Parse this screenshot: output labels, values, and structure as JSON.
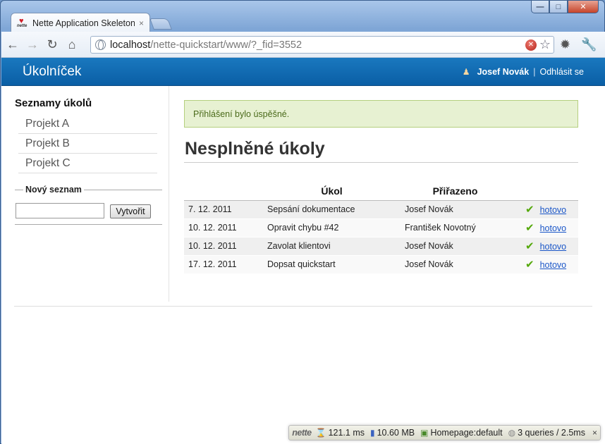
{
  "browser": {
    "tab_title": "Nette Application Skeleton",
    "tab_close": "×",
    "url_host": "localhost",
    "url_rest": "/nette-quickstart/www/?_fid=3552",
    "min_label": "—",
    "max_label": "□",
    "close_label": "✕"
  },
  "header": {
    "brand": "Úkolníček",
    "user_name": "Josef Novák",
    "separator": "|",
    "logout": "Odhlásit se"
  },
  "sidebar": {
    "title": "Seznamy úkolů",
    "projects": [
      "Projekt A",
      "Projekt B",
      "Projekt C"
    ],
    "new_list_legend": "Nový seznam",
    "new_list_value": "",
    "create_button": "Vytvořit"
  },
  "main": {
    "flash": "Přihlášení bylo úspěšné.",
    "heading": "Nesplněné úkoly",
    "columns": [
      "",
      "Úkol",
      "Přiřazeno",
      ""
    ],
    "tasks": [
      {
        "date": "7. 12. 2011",
        "task": "Sepsání dokumentace",
        "assigned": "Josef Novák",
        "action": "hotovo"
      },
      {
        "date": "10. 12. 2011",
        "task": "Opravit chybu #42",
        "assigned": "František Novotný",
        "action": "hotovo"
      },
      {
        "date": "10. 12. 2011",
        "task": "Zavolat klientovi",
        "assigned": "Josef Novák",
        "action": "hotovo"
      },
      {
        "date": "17. 12. 2011",
        "task": "Dopsat quickstart",
        "assigned": "Josef Novák",
        "action": "hotovo"
      }
    ]
  },
  "debugbar": {
    "logo": "nette",
    "time": "121.1 ms",
    "memory": "10.60 MB",
    "presenter": "Homepage:default",
    "queries": "3 queries / 2.5ms",
    "close": "×"
  },
  "colors": {
    "header_bg": "#0a5ea5",
    "flash_bg": "#e7f1d2",
    "link": "#1a56c8",
    "check": "#54a80a"
  }
}
